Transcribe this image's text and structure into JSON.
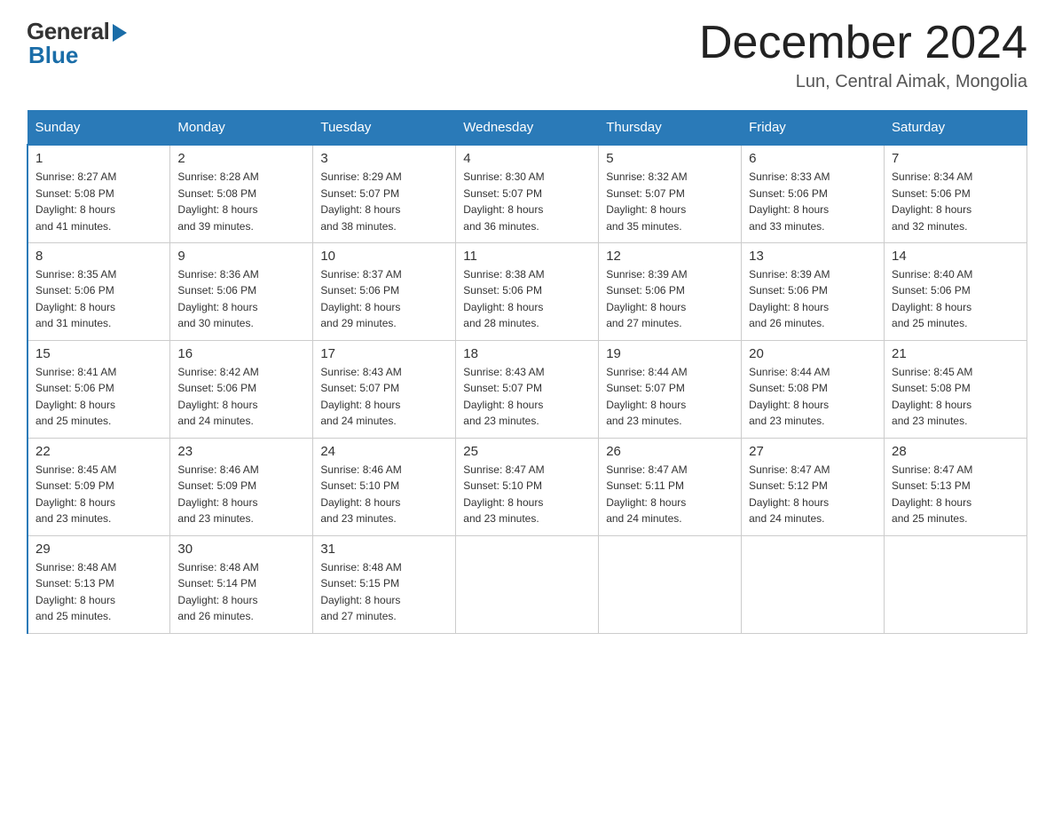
{
  "header": {
    "logo_general": "General",
    "logo_blue": "Blue",
    "month_title": "December 2024",
    "location": "Lun, Central Aimak, Mongolia"
  },
  "days_of_week": [
    "Sunday",
    "Monday",
    "Tuesday",
    "Wednesday",
    "Thursday",
    "Friday",
    "Saturday"
  ],
  "weeks": [
    [
      {
        "day": "1",
        "sunrise": "8:27 AM",
        "sunset": "5:08 PM",
        "daylight": "8 hours and 41 minutes."
      },
      {
        "day": "2",
        "sunrise": "8:28 AM",
        "sunset": "5:08 PM",
        "daylight": "8 hours and 39 minutes."
      },
      {
        "day": "3",
        "sunrise": "8:29 AM",
        "sunset": "5:07 PM",
        "daylight": "8 hours and 38 minutes."
      },
      {
        "day": "4",
        "sunrise": "8:30 AM",
        "sunset": "5:07 PM",
        "daylight": "8 hours and 36 minutes."
      },
      {
        "day": "5",
        "sunrise": "8:32 AM",
        "sunset": "5:07 PM",
        "daylight": "8 hours and 35 minutes."
      },
      {
        "day": "6",
        "sunrise": "8:33 AM",
        "sunset": "5:06 PM",
        "daylight": "8 hours and 33 minutes."
      },
      {
        "day": "7",
        "sunrise": "8:34 AM",
        "sunset": "5:06 PM",
        "daylight": "8 hours and 32 minutes."
      }
    ],
    [
      {
        "day": "8",
        "sunrise": "8:35 AM",
        "sunset": "5:06 PM",
        "daylight": "8 hours and 31 minutes."
      },
      {
        "day": "9",
        "sunrise": "8:36 AM",
        "sunset": "5:06 PM",
        "daylight": "8 hours and 30 minutes."
      },
      {
        "day": "10",
        "sunrise": "8:37 AM",
        "sunset": "5:06 PM",
        "daylight": "8 hours and 29 minutes."
      },
      {
        "day": "11",
        "sunrise": "8:38 AM",
        "sunset": "5:06 PM",
        "daylight": "8 hours and 28 minutes."
      },
      {
        "day": "12",
        "sunrise": "8:39 AM",
        "sunset": "5:06 PM",
        "daylight": "8 hours and 27 minutes."
      },
      {
        "day": "13",
        "sunrise": "8:39 AM",
        "sunset": "5:06 PM",
        "daylight": "8 hours and 26 minutes."
      },
      {
        "day": "14",
        "sunrise": "8:40 AM",
        "sunset": "5:06 PM",
        "daylight": "8 hours and 25 minutes."
      }
    ],
    [
      {
        "day": "15",
        "sunrise": "8:41 AM",
        "sunset": "5:06 PM",
        "daylight": "8 hours and 25 minutes."
      },
      {
        "day": "16",
        "sunrise": "8:42 AM",
        "sunset": "5:06 PM",
        "daylight": "8 hours and 24 minutes."
      },
      {
        "day": "17",
        "sunrise": "8:43 AM",
        "sunset": "5:07 PM",
        "daylight": "8 hours and 24 minutes."
      },
      {
        "day": "18",
        "sunrise": "8:43 AM",
        "sunset": "5:07 PM",
        "daylight": "8 hours and 23 minutes."
      },
      {
        "day": "19",
        "sunrise": "8:44 AM",
        "sunset": "5:07 PM",
        "daylight": "8 hours and 23 minutes."
      },
      {
        "day": "20",
        "sunrise": "8:44 AM",
        "sunset": "5:08 PM",
        "daylight": "8 hours and 23 minutes."
      },
      {
        "day": "21",
        "sunrise": "8:45 AM",
        "sunset": "5:08 PM",
        "daylight": "8 hours and 23 minutes."
      }
    ],
    [
      {
        "day": "22",
        "sunrise": "8:45 AM",
        "sunset": "5:09 PM",
        "daylight": "8 hours and 23 minutes."
      },
      {
        "day": "23",
        "sunrise": "8:46 AM",
        "sunset": "5:09 PM",
        "daylight": "8 hours and 23 minutes."
      },
      {
        "day": "24",
        "sunrise": "8:46 AM",
        "sunset": "5:10 PM",
        "daylight": "8 hours and 23 minutes."
      },
      {
        "day": "25",
        "sunrise": "8:47 AM",
        "sunset": "5:10 PM",
        "daylight": "8 hours and 23 minutes."
      },
      {
        "day": "26",
        "sunrise": "8:47 AM",
        "sunset": "5:11 PM",
        "daylight": "8 hours and 24 minutes."
      },
      {
        "day": "27",
        "sunrise": "8:47 AM",
        "sunset": "5:12 PM",
        "daylight": "8 hours and 24 minutes."
      },
      {
        "day": "28",
        "sunrise": "8:47 AM",
        "sunset": "5:13 PM",
        "daylight": "8 hours and 25 minutes."
      }
    ],
    [
      {
        "day": "29",
        "sunrise": "8:48 AM",
        "sunset": "5:13 PM",
        "daylight": "8 hours and 25 minutes."
      },
      {
        "day": "30",
        "sunrise": "8:48 AM",
        "sunset": "5:14 PM",
        "daylight": "8 hours and 26 minutes."
      },
      {
        "day": "31",
        "sunrise": "8:48 AM",
        "sunset": "5:15 PM",
        "daylight": "8 hours and 27 minutes."
      },
      null,
      null,
      null,
      null
    ]
  ],
  "labels": {
    "sunrise": "Sunrise:",
    "sunset": "Sunset:",
    "daylight": "Daylight:"
  }
}
